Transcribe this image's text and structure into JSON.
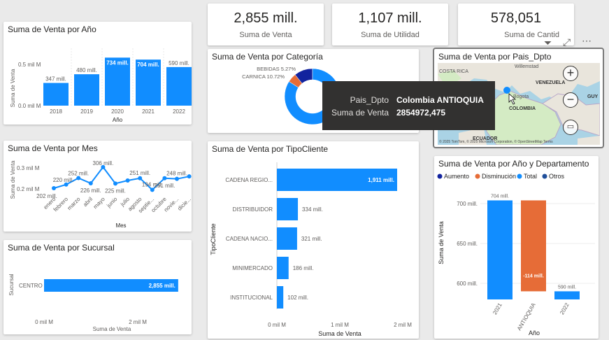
{
  "kpis": [
    {
      "value": "2,855 mill.",
      "label": "Suma de Venta"
    },
    {
      "value": "1,107 mill.",
      "label": "Suma de Utilidad"
    },
    {
      "value": "578,051",
      "label": "Suma de Cantid"
    }
  ],
  "colors": {
    "accent": "#118dff",
    "dark_navy": "#12239e",
    "orange": "#e66c37",
    "darker_blue": "#1f4e9a",
    "tooltip_bg": "#323130"
  },
  "year_chart": {
    "title": "Suma de Venta por Año",
    "ylabel": "Suma de Venta",
    "xlabel": "Año",
    "y_ticks": [
      "0.5 mil M",
      "0.0 mil M"
    ]
  },
  "month_chart": {
    "title": "Suma de Venta por Mes",
    "ylabel": "Suma de Venta",
    "xlabel": "Mes",
    "y_ticks": [
      "0.3 mil M",
      "0.2 mil M"
    ]
  },
  "branch_chart": {
    "title": "Suma de Venta por Sucursal",
    "ylabel": "Sucursal",
    "xlabel": "Suma de Venta",
    "x_ticks": [
      "0 mil M",
      "2 mil M"
    ]
  },
  "category_chart": {
    "title": "Suma de Venta por Categoría"
  },
  "customer_chart": {
    "title": "Suma de Venta por TipoCliente",
    "ylabel": "TipoCliente",
    "xlabel": "Suma de Venta",
    "x_ticks": [
      "0 mil M",
      "1 mil M",
      "2 mil M"
    ]
  },
  "map_chart": {
    "title": "Suma de Venta por Pais_Dpto",
    "labels": [
      "COSTA RICA",
      "VENEZUELA",
      "Bogota",
      "COLOMBIA",
      "ECUADOR",
      "Willemstad",
      "GUY"
    ],
    "attribution": "© 2025 TomTom, © 2025 Microsoft Corporation, © OpenStreetMap Terms",
    "icons": [
      "zoom-in",
      "zoom-out",
      "map-style",
      "filter",
      "focus",
      "more-options"
    ]
  },
  "tooltip": {
    "key1": "Pais_Dpto",
    "val1": "Colombia ANTIOQUIA",
    "key2": "Suma de Venta",
    "val2": "2854972,475"
  },
  "waterfall_chart": {
    "title": "Suma de Venta por Año y Departamento",
    "legend": [
      "Aumento",
      "Disminución",
      "Total",
      "Otros"
    ],
    "ylabel": "Suma de Venta",
    "xlabel": "Año",
    "y_ticks": [
      "700 mill.",
      "650 mill.",
      "600 mill."
    ]
  },
  "chart_data": [
    {
      "type": "bar",
      "title": "Suma de Venta por Año",
      "categories": [
        "2018",
        "2019",
        "2020",
        "2021",
        "2022"
      ],
      "values": [
        347,
        480,
        734,
        704,
        590
      ],
      "data_labels": [
        "347 mill.",
        "480 mill.",
        "734 mill.",
        "704 mill.",
        "590 mill."
      ],
      "xlabel": "Año",
      "ylabel": "Suma de Venta",
      "ylim": [
        0,
        800
      ]
    },
    {
      "type": "line",
      "title": "Suma de Venta por Mes",
      "categories": [
        "enero",
        "febrero",
        "marzo",
        "abril",
        "mayo",
        "junio",
        "julio",
        "agosto",
        "septie...",
        "octubre",
        "novie...",
        "dicie..."
      ],
      "values": [
        202,
        220,
        252,
        226,
        306,
        225,
        240,
        251,
        194,
        251,
        248,
        260
      ],
      "data_labels": [
        "202 mill.",
        "220 mill.",
        "252 mill.",
        "226 mill.",
        "306 mill.",
        "225 mill.",
        "",
        "251 mill.",
        "194 mill.",
        "251 mill.",
        "248 mill.",
        ""
      ],
      "xlabel": "Mes",
      "ylabel": "Suma de Venta",
      "ylim": [
        120,
        360
      ]
    },
    {
      "type": "bar",
      "title": "Suma de Venta por Sucursal",
      "categories": [
        "CENTRO"
      ],
      "values": [
        2855
      ],
      "data_labels": [
        "2,855 mill."
      ],
      "xlabel": "Suma de Venta",
      "ylabel": "Sucursal",
      "xlim": [
        0,
        3000
      ]
    },
    {
      "type": "pie",
      "title": "Suma de Venta por Categoría",
      "categories": [
        "BEBIDAS",
        "CARNICA",
        "Otros"
      ],
      "values": [
        5.27,
        10.72,
        84.01
      ],
      "data_labels": [
        "BEBIDAS 5.27%",
        "CARNICA 10.72%"
      ]
    },
    {
      "type": "bar",
      "title": "Suma de Venta por TipoCliente",
      "categories": [
        "CADENA REGIO...",
        "DISTRIBUIDOR",
        "CADENA NACIO...",
        "MINIMERCADO",
        "INSTITUCIONAL"
      ],
      "values": [
        1911,
        334,
        321,
        186,
        102
      ],
      "data_labels": [
        "1,911 mill.",
        "334 mill.",
        "321 mill.",
        "186 mill.",
        "102 mill."
      ],
      "xlabel": "Suma de Venta",
      "ylabel": "TipoCliente",
      "xlim": [
        0,
        2000
      ]
    },
    {
      "type": "bar",
      "title": "Suma de Venta por Año y Departamento",
      "categories": [
        "2021",
        "ANTIOQUIA",
        "2022"
      ],
      "series": [
        {
          "name": "Total",
          "values": [
            704,
            null,
            590
          ]
        },
        {
          "name": "Disminución",
          "values": [
            null,
            -114,
            null
          ]
        }
      ],
      "data_labels": [
        "704 mill.",
        "-114 mill.",
        "590 mill."
      ],
      "xlabel": "Año",
      "ylabel": "Suma de Venta",
      "ylim": [
        575,
        720
      ]
    }
  ]
}
